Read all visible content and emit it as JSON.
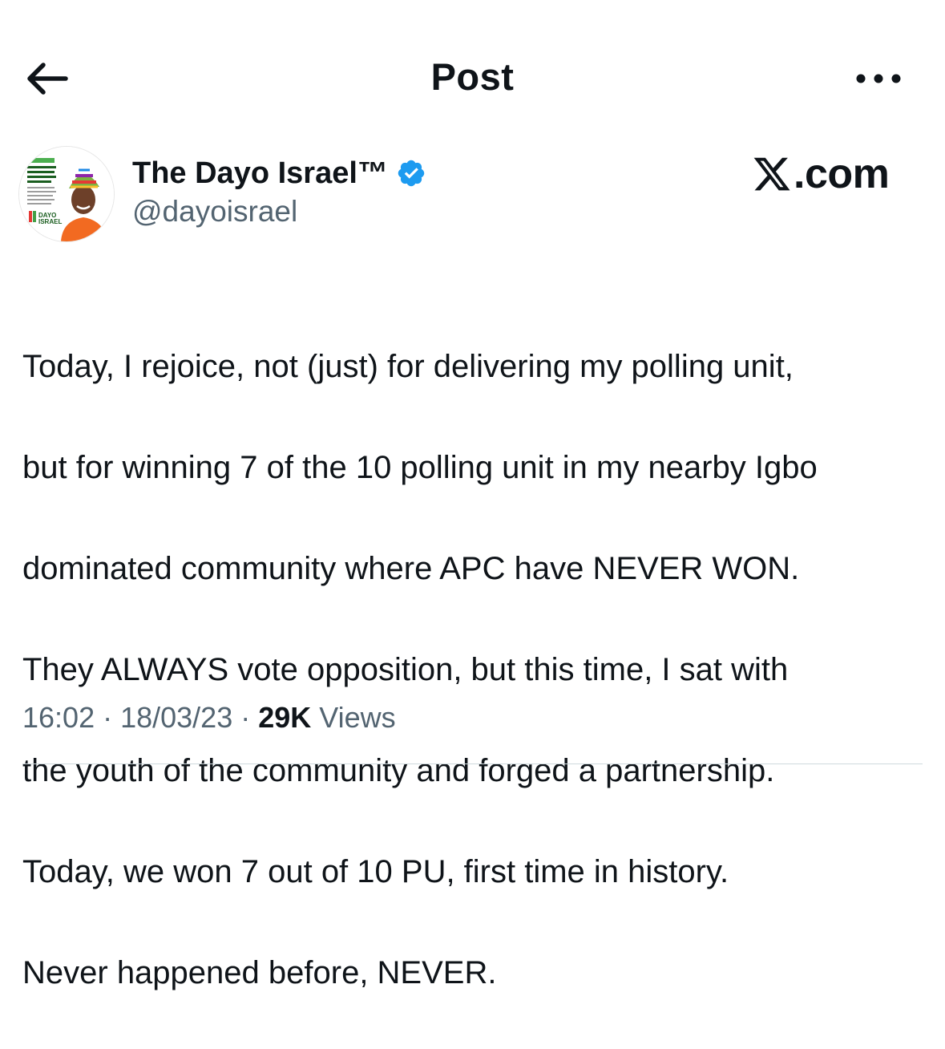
{
  "header": {
    "title": "Post",
    "back_icon": "arrow-left-icon",
    "more_icon": "more-horizontal-icon"
  },
  "author": {
    "display_name": "The Dayo Israel™",
    "handle": "@dayoisrael",
    "verified": true,
    "verified_color": "#1d9bf0",
    "avatar_text": {
      "line1": "DAYO",
      "line2": "ISRAEL"
    }
  },
  "watermark": {
    "text": ".com",
    "icon": "x-logo-icon"
  },
  "post": {
    "lines": [
      "Today, I rejoice, not (just) for delivering my polling unit,",
      "but for winning 7 of the 10 polling unit in my nearby Igbo",
      "dominated community where APC have NEVER WON.",
      "They ALWAYS vote opposition, but this time, I sat with",
      "the youth of the community and forged a partnership.",
      "Today, we won 7 out of 10 PU, first time in history.",
      "Never happened before, NEVER."
    ]
  },
  "meta": {
    "time": "16:02",
    "date": "18/03/23",
    "separator": " · ",
    "views_count": "29K",
    "views_label": "Views"
  },
  "colors": {
    "text_primary": "#0f1419",
    "text_secondary": "#536471",
    "divider": "#cfd9de"
  }
}
